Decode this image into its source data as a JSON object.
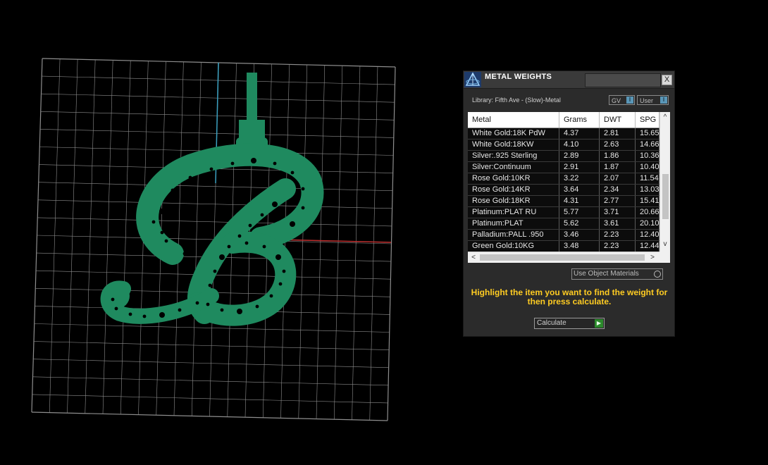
{
  "panel": {
    "title": "METAL WEIGHTS",
    "close_label": "X",
    "library_text": "Library: Fifth Ave - (Slow)-Metal",
    "toggles": [
      {
        "label": "GV",
        "knob": "I"
      },
      {
        "label": "User",
        "knob": "I"
      }
    ],
    "table": {
      "headers": [
        "Metal",
        "Grams",
        "DWT",
        "SPG"
      ],
      "rows": [
        [
          "White Gold:18K PdW",
          "4.37",
          "2.81",
          "15.65"
        ],
        [
          "White Gold:18KW",
          "4.10",
          "2.63",
          "14.66"
        ],
        [
          "Silver:.925 Sterling",
          "2.89",
          "1.86",
          "10.36"
        ],
        [
          "Silver:Continuum",
          "2.91",
          "1.87",
          "10.40"
        ],
        [
          "Rose Gold:10KR",
          "3.22",
          "2.07",
          "11.54"
        ],
        [
          "Rose Gold:14KR",
          "3.64",
          "2.34",
          "13.03"
        ],
        [
          "Rose Gold:18KR",
          "4.31",
          "2.77",
          "15.41"
        ],
        [
          "Platinum:PLAT RU",
          "5.77",
          "3.71",
          "20.66"
        ],
        [
          "Platinum:PLAT",
          "5.62",
          "3.61",
          "20.10"
        ],
        [
          "Palladium:PALL .950",
          "3.46",
          "2.23",
          "12.40"
        ],
        [
          "Green Gold:10KG",
          "3.48",
          "2.23",
          "12.44"
        ]
      ]
    },
    "scroll": {
      "up": "^",
      "down": "v",
      "left": "<",
      "right": ">"
    },
    "use_object_materials": "Use Object Materials",
    "instructions": "Highlight the item you want to find the weight for then press calculate.",
    "calculate_label": "Calculate",
    "calculate_icon": "play-arrow"
  },
  "viewport": {
    "model_color": "#1f8a5f",
    "grid_color": "#8e8e8e",
    "axis_x_color": "#c03030",
    "axis_y_color": "#3aa0c0"
  }
}
